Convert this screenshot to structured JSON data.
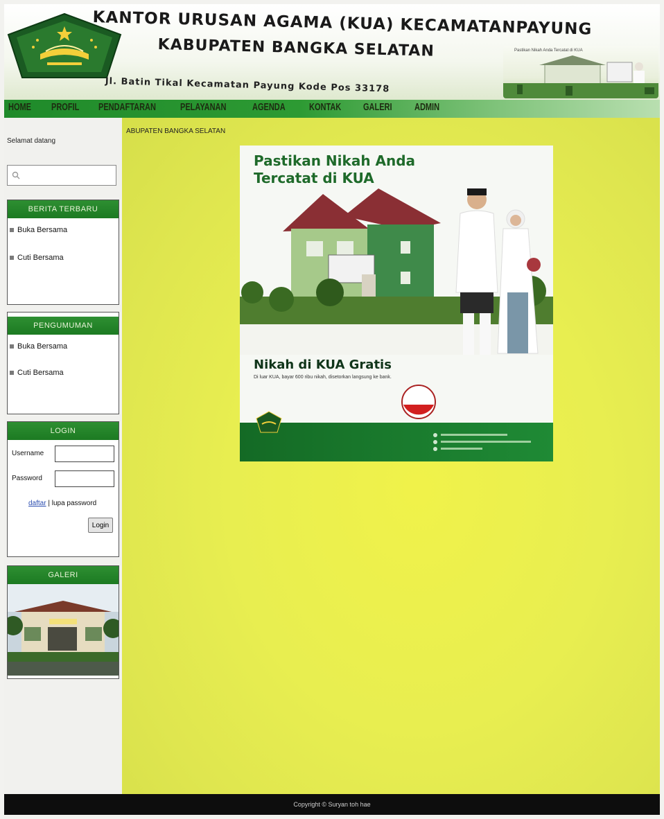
{
  "header": {
    "title_line1": "KANTOR URUSAN AGAMA (KUA) KECAMATANPAYUNG",
    "title_line2": "KABUPATEN BANGKA SELATAN",
    "address": "Jl. Batin Tikal Kecamatan Payung Kode Pos 33178",
    "banner_caption": "Pastikan Nikah Anda Tercatat di KUA"
  },
  "nav": {
    "items": [
      "HOME",
      "PROFIL",
      "PENDAFTARAN",
      "PELAYANAN",
      "AGENDA",
      "KONTAK",
      "GALERI",
      "ADMIN"
    ]
  },
  "sidebar": {
    "welcome": "Selamat datang",
    "search_placeholder": "",
    "news": {
      "title": "BERITA TERBARU",
      "items": [
        "Buka Bersama",
        "Cuti Bersama"
      ]
    },
    "announcements": {
      "title": "PENGUMUMAN",
      "items": [
        "Buka Bersama",
        "Cuti Bersama"
      ]
    },
    "login": {
      "title": "LOGIN",
      "username_label": "Username",
      "password_label": "Password",
      "register_link": "daftar",
      "separator": "|",
      "forgot_link": "lupa password",
      "button": "Login"
    },
    "gallery": {
      "title": "GALERI"
    }
  },
  "main": {
    "breadcrumb": "ABUPATEN BANGKA SELATAN",
    "poster": {
      "title": "Pastikan Nikah Anda Tercatat di KUA",
      "heading": "Nikah di KUA Gratis",
      "text": "Di luar KUA, bayar 600 ribu nikah, disetorkan langsung ke bank."
    }
  },
  "footer": {
    "copyright": "Copyright © Suryan toh hae"
  },
  "colors": {
    "nav_green": "#1f8a2a",
    "panel_header": "#2e8f32",
    "main_background": "#e8ee50",
    "footer": "#0d0d0d"
  }
}
